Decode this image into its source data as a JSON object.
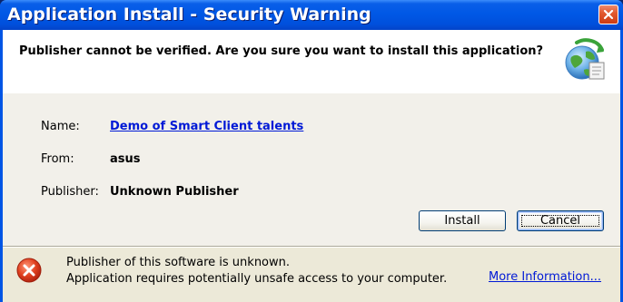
{
  "window": {
    "title": "Application Install - Security Warning"
  },
  "header": {
    "question": "Publisher cannot be verified. Are you sure you want to install this application?",
    "icon": "install-globe-icon"
  },
  "details": {
    "name_label": "Name:",
    "name_value": "Demo of Smart Client talents",
    "from_label": "From:",
    "from_value": "asus",
    "publisher_label": "Publisher:",
    "publisher_value": "Unknown Publisher"
  },
  "buttons": {
    "install": "Install",
    "cancel": "Cancel"
  },
  "footer": {
    "icon": "error-x-icon",
    "line1": "Publisher of this software is unknown.",
    "line2": "Application requires potentially unsafe access to your computer.",
    "more_link": "More Information..."
  },
  "colors": {
    "titlebar": "#0058e6",
    "link": "#0019d6",
    "dialog_bg": "#ece9d8",
    "error_red": "#d8341c"
  }
}
